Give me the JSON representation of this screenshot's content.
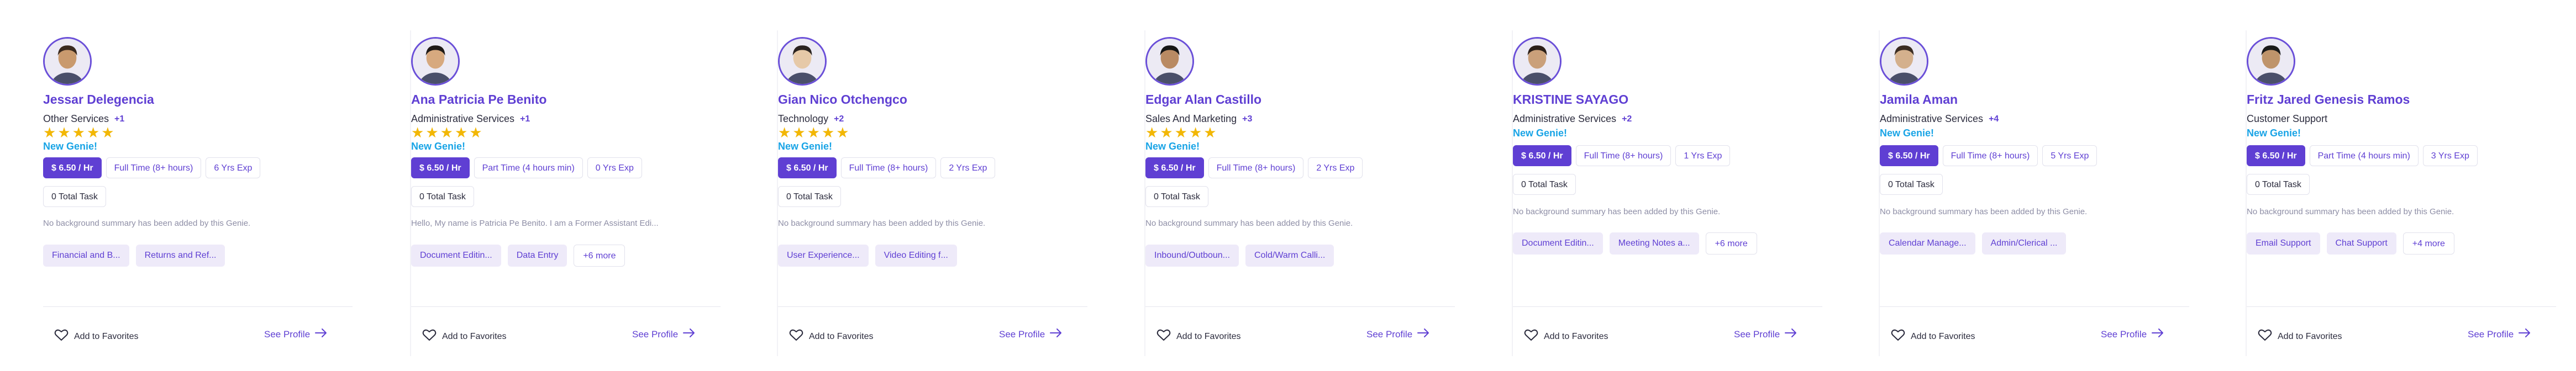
{
  "colors": {
    "accent": "#5f3fd3",
    "new_genie": "#19a4e6",
    "star": "#f2b705"
  },
  "labels": {
    "new_genie": "New Genie!",
    "total_task": "0 Total Task",
    "summary": "No background summary has been added by this Genie.",
    "add_favorites": "Add to Favorites",
    "see_profile": "See Profile"
  },
  "cards": [
    {
      "name": "Jessar Delegencia",
      "category": "Other Services",
      "category_more": "+1",
      "rating": 5,
      "rate": "$ 6.50 / Hr",
      "schedule": "Full Time (8+ hours)",
      "experience": "6 Yrs Exp",
      "summary": "No background summary has been added by this Genie.",
      "skills": [
        "Financial and B...",
        "Returns and Ref..."
      ],
      "skills_more": ""
    },
    {
      "name": "Ana Patricia Pe Benito",
      "category": "Administrative Services",
      "category_more": "+1",
      "rating": 5,
      "rate": "$ 6.50 / Hr",
      "schedule": "Part Time (4 hours min)",
      "experience": "0 Yrs Exp",
      "summary": "Hello, My name is Patricia Pe Benito. I am a Former Assistant Edi...",
      "skills": [
        "Document Editin...",
        "Data Entry"
      ],
      "skills_more": "+6 more"
    },
    {
      "name": "Gian Nico Otchengco",
      "category": "Technology",
      "category_more": "+2",
      "rating": 5,
      "rate": "$ 6.50 / Hr",
      "schedule": "Full Time (8+ hours)",
      "experience": "2 Yrs Exp",
      "summary": "No background summary has been added by this Genie.",
      "skills": [
        "User Experience...",
        "Video Editing f..."
      ],
      "skills_more": ""
    },
    {
      "name": "Edgar Alan Castillo",
      "category": "Sales And Marketing",
      "category_more": "+3",
      "rating": 5,
      "rate": "$ 6.50 / Hr",
      "schedule": "Full Time (8+ hours)",
      "experience": "2 Yrs Exp",
      "summary": "No background summary has been added by this Genie.",
      "skills": [
        "Inbound/Outboun...",
        "Cold/Warm Calli..."
      ],
      "skills_more": ""
    },
    {
      "name": "KRISTINE SAYAGO",
      "category": "Administrative Services",
      "category_more": "+2",
      "rating": 0,
      "rate": "$ 6.50 / Hr",
      "schedule": "Full Time (8+ hours)",
      "experience": "1 Yrs Exp",
      "summary": "No background summary has been added by this Genie.",
      "skills": [
        "Document Editin...",
        "Meeting Notes a..."
      ],
      "skills_more": "+6 more"
    },
    {
      "name": "Jamila Aman",
      "category": "Administrative Services",
      "category_more": "+4",
      "rating": 0,
      "rate": "$ 6.50 / Hr",
      "schedule": "Full Time (8+ hours)",
      "experience": "5 Yrs Exp",
      "summary": "No background summary has been added by this Genie.",
      "skills": [
        "Calendar Manage...",
        "Admin/Clerical ..."
      ],
      "skills_more": ""
    },
    {
      "name": "Fritz Jared Genesis Ramos",
      "category": "Customer Support",
      "category_more": "",
      "rating": 0,
      "rate": "$ 6.50 / Hr",
      "schedule": "Part Time (4 hours min)",
      "experience": "3 Yrs Exp",
      "summary": "No background summary has been added by this Genie.",
      "skills": [
        "Email Support",
        "Chat Support"
      ],
      "skills_more": "+4 more"
    }
  ]
}
